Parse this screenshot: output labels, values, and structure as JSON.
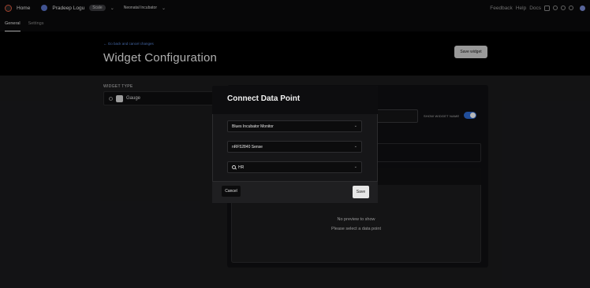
{
  "topbar": {
    "home_label": "Home",
    "user_name": "Pradeep Logu",
    "plan_badge": "Scale",
    "project_name": "Neonatal Incubator",
    "links": [
      "Feedback",
      "Help",
      "Docs"
    ]
  },
  "tabs": [
    {
      "label": "General",
      "active": true
    },
    {
      "label": "Settings",
      "active": false
    }
  ],
  "header": {
    "back_link": "← Go back and cancel changes",
    "title": "Widget Configuration",
    "save_widget_label": "Save widget"
  },
  "widget_type": {
    "label": "WIDGET TYPE",
    "selected": "Gauge"
  },
  "settings_panel": {
    "show_widget_name_label": "SHOW WIDGET NAME",
    "show_widget_name_enabled": true
  },
  "preview": {
    "no_preview": "No preview to show",
    "hint": "Please select a data point"
  },
  "modal": {
    "title": "Connect Data Point",
    "device_select": "Blues Incubator Monitor",
    "sensor_select": "nRF52840 Sense",
    "search_value": "HR",
    "cancel_label": "Cancel",
    "save_label": "Save"
  },
  "colors": {
    "accent_blue": "#2f6cd6",
    "link_blue": "#5d8ce0",
    "logo_orange": "#e05a3f"
  }
}
